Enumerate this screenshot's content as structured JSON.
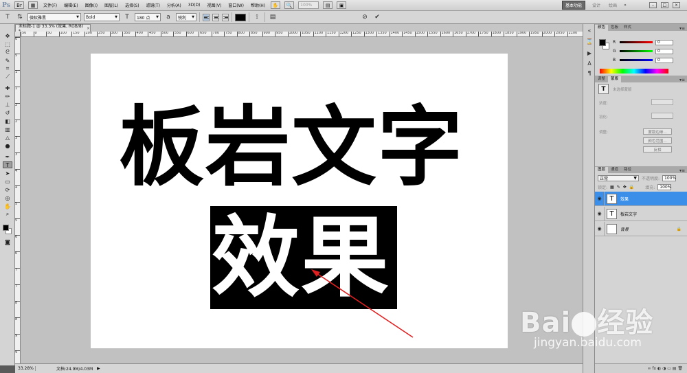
{
  "menubar": {
    "logo": "Ps",
    "items": [
      "文件(F)",
      "编辑(E)",
      "图像(I)",
      "图层(L)",
      "选择(S)",
      "滤镜(T)",
      "分析(A)",
      "3D(D)",
      "视图(V)",
      "窗口(W)",
      "帮助(H)"
    ],
    "zoom": "100%",
    "workspaces": {
      "active": "基本功能",
      "design": "设计",
      "paint": "绘画",
      "more": "»"
    },
    "window_buttons": {
      "min": "–",
      "max": "□",
      "close": "×"
    }
  },
  "options": {
    "font_family": "微软雅黑",
    "font_style": "Bold",
    "font_size": "180 点",
    "antialias": "锐利",
    "text_color": "#000000"
  },
  "document": {
    "tab_title": "未标题-1 @ 33.3% (效果, RGB/8) *",
    "tab_close": "×",
    "title_text": "板岩文字",
    "effect_text": "效果",
    "ruler_top_labels": [
      "50",
      "0",
      "50",
      "100",
      "150",
      "200",
      "250",
      "300",
      "350",
      "400",
      "450",
      "500",
      "550",
      "600",
      "650",
      "700",
      "750",
      "800",
      "850",
      "900",
      "950",
      "1000",
      "1050",
      "1100",
      "1150",
      "1200",
      "1250",
      "1300",
      "1350",
      "1400",
      "1450",
      "1500",
      "1550",
      "1600",
      "1650",
      "1700",
      "1750",
      "1800",
      "1850",
      "1900",
      "1950",
      "2000",
      "2050",
      "2100"
    ],
    "ruler_left_labels": [
      "0",
      "5",
      "1",
      "1",
      "2",
      "2",
      "3",
      "3",
      "4",
      "4",
      "5",
      "5",
      "6",
      "6",
      "7",
      "7",
      "8",
      "8",
      "9",
      "9"
    ],
    "annotation_arrow_color": "#e02020"
  },
  "statusbar": {
    "zoom": "33.28%",
    "doc_info": "文档:24.9M/4.03M",
    "arrow": "▶"
  },
  "color_panel": {
    "tabs": [
      "颜色",
      "色板",
      "样式"
    ],
    "menu": "▾≡",
    "r": {
      "label": "R",
      "value": "0"
    },
    "g": {
      "label": "G",
      "value": "0"
    },
    "b": {
      "label": "B",
      "value": "0"
    }
  },
  "mask_panel": {
    "tabs": [
      "调整",
      "蒙版"
    ],
    "info": "未选择蒙版",
    "density_label": "浓度:",
    "feather_label": "羽化:",
    "refine_label": "调整:",
    "btn_edge": "蒙版边缘...",
    "btn_color_range": "颜色范围...",
    "btn_invert": "反相"
  },
  "layers_panel": {
    "tabs": [
      "图层",
      "通道",
      "路径"
    ],
    "blend_mode": "正常",
    "opacity_label": "不透明度:",
    "opacity_value": "100%",
    "lock_label": "锁定:",
    "fill_label": "填充:",
    "fill_value": "100%",
    "layers": [
      {
        "name": "效果",
        "thumb": "T",
        "selected": true
      },
      {
        "name": "板岩文字",
        "thumb": "T",
        "selected": false
      },
      {
        "name": "背景",
        "thumb": "",
        "selected": false,
        "locked": true
      }
    ],
    "footer_icons": "∞  fx  ◐  ◑  ▭  ▤  🗑"
  },
  "watermark": {
    "logo_left": "Bai",
    "logo_right": "经验",
    "url": "jingyan.baidu.com"
  }
}
